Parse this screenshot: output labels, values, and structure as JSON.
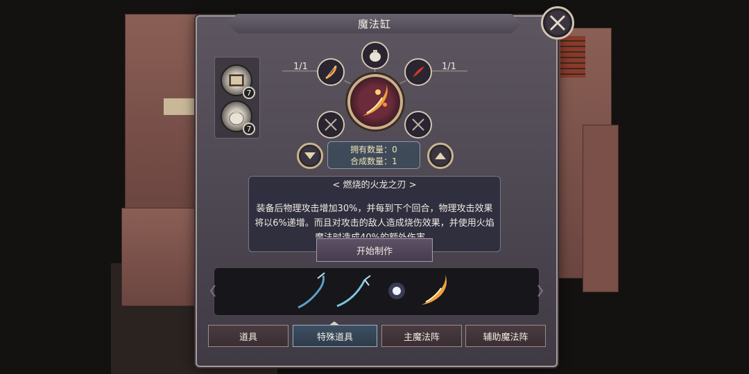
{
  "window": {
    "title": "魔法缸"
  },
  "recipe": {
    "left_ratio": "1/1",
    "right_ratio": "1/1",
    "owned_label": "拥有数量：0",
    "craftable_label": "合成数量：1"
  },
  "materials": [
    {
      "icon": "spellbook-icon",
      "count": "7"
    },
    {
      "icon": "pouch-icon",
      "count": "7"
    }
  ],
  "item": {
    "name": "< 燃烧的火龙之刃 >",
    "description": "装备后物理攻击增加30%，并每到下个回合，物理攻击效果将以6%递增。而且对攻击的敌人造成烧伤效果，并使用火焰魔法时造成40%的额外伤害。"
  },
  "craft_button": "开始制作",
  "tabs": [
    {
      "label": "道具",
      "active": false
    },
    {
      "label": "特殊道具",
      "active": true
    },
    {
      "label": "主魔法阵",
      "active": false
    },
    {
      "label": "辅助魔法阵",
      "active": false
    }
  ],
  "colors": {
    "accent": "#cbb58f",
    "active_tab": "#3c4f62",
    "count_text": "#efe2b8"
  }
}
